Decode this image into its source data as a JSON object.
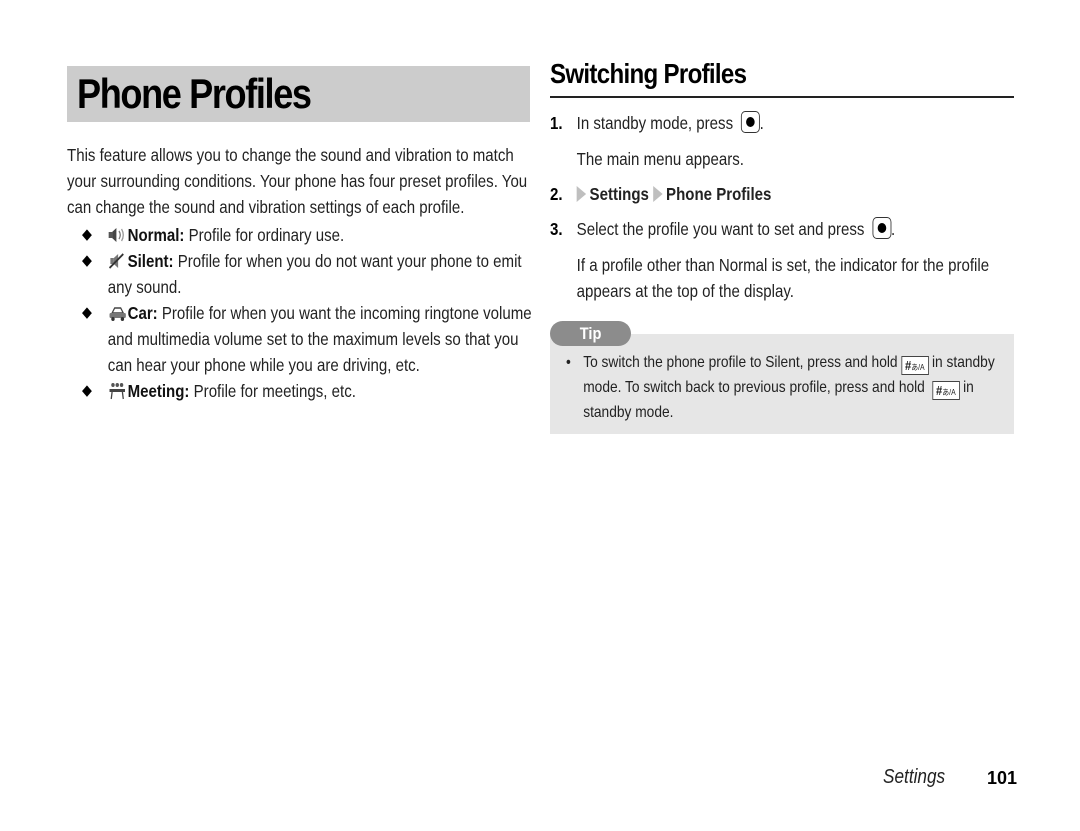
{
  "left": {
    "title": "Phone Profiles",
    "intro": "This feature allows you to change the sound and vibration to match your surrounding conditions. Your phone has four preset profiles. You can change the sound and vibration settings of each profile.",
    "bullets": [
      {
        "icon": "speaker-icon",
        "name": "Normal:",
        "text": " Profile for ordinary use."
      },
      {
        "icon": "silent-speaker-icon",
        "name": "Silent:",
        "text": " Profile for when you do not want your phone to emit any sound."
      },
      {
        "icon": "car-icon",
        "name": "Car:",
        "text": " Profile for when you want the incoming ringtone volume and multimedia volume set to the maximum levels so that you can hear your phone while you are driving, etc."
      },
      {
        "icon": "meeting-icon",
        "name": "Meeting:",
        "text": " Profile for meetings, etc."
      }
    ]
  },
  "right": {
    "title": "Switching Profiles",
    "steps": [
      {
        "num": "1.",
        "text": "In standby mode, press",
        "suffix": ".",
        "sub": "The main menu appears."
      },
      {
        "num": "2.",
        "path": [
          "Settings",
          "Phone Profiles"
        ]
      },
      {
        "num": "3.",
        "text": "Select the profile you want to set and press",
        "suffix": ".",
        "sub": "If a profile other than Normal is set, the indicator for the profile appears at the top of the display."
      }
    ],
    "tip": {
      "label": "Tip",
      "bullet": "•",
      "text_a": "To switch the phone profile to Silent, press and hold",
      "text_b": "in standby mode. To switch back to previous profile, press and hold",
      "text_c": "in standby mode.",
      "key_label": "#",
      "key_sub": "あ/A"
    }
  },
  "footer": {
    "section": "Settings",
    "page": "101"
  }
}
